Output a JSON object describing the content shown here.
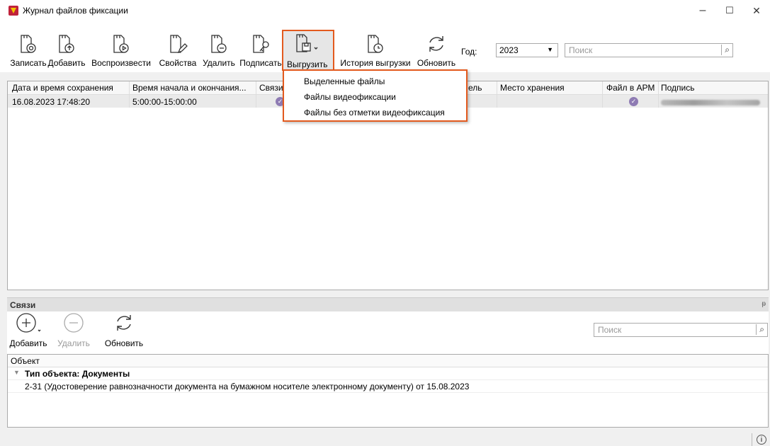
{
  "window": {
    "title": "Журнал файлов фиксации",
    "minimize": "–",
    "maximize": "☐",
    "close": "✕"
  },
  "toolbar": {
    "buttons": [
      {
        "label": "Записать",
        "icon": "record-file-icon"
      },
      {
        "label": "Добавить",
        "icon": "add-file-icon"
      },
      {
        "label": "Воспроизвести",
        "icon": "play-file-icon"
      },
      {
        "label": "Свойства",
        "icon": "properties-file-icon"
      },
      {
        "label": "Удалить",
        "icon": "delete-file-icon"
      },
      {
        "label": "Подписать",
        "icon": "sign-file-icon"
      },
      {
        "label": "Выгрузить",
        "icon": "export-file-icon"
      },
      {
        "label": "История выгрузки",
        "icon": "export-history-icon"
      },
      {
        "label": "Обновить",
        "icon": "refresh-icon"
      }
    ],
    "year_label": "Год:",
    "year_value": "2023",
    "search_placeholder": "Поиск"
  },
  "table": {
    "columns": [
      "Дата и время сохранения",
      "Время начала и окончания...",
      "Связи",
      "ель",
      "Место хранения",
      "Файл в АРМ",
      "Подпись"
    ],
    "rows": [
      {
        "saved": "16.08.2023 17:48:20",
        "period": "5:00:00-15:00:00",
        "links_icon": "check-icon",
        "file_in_arm": "check-icon"
      }
    ]
  },
  "export_menu": {
    "items": [
      "Выделенные файлы",
      "Файлы видеофиксации",
      "Файлы без отметки видеофиксация"
    ]
  },
  "links_panel": {
    "title": "Связи",
    "pin": "ᵽ",
    "buttons": [
      {
        "label": "Добавить",
        "icon": "plus-circle-icon"
      },
      {
        "label": "Удалить",
        "icon": "minus-circle-icon"
      },
      {
        "label": "Обновить",
        "icon": "refresh-icon"
      }
    ],
    "search_placeholder": "Поиск",
    "column": "Объект",
    "group": "Тип объекта: Документы",
    "item": "2-31 (Удостоверение равнозначности документа на бумажном носителе электронному документу) от 15.08.2023"
  },
  "status": {
    "info_icon": "info-icon"
  },
  "colors": {
    "highlight": "#e35a1e",
    "check": "#8e7bb3"
  }
}
